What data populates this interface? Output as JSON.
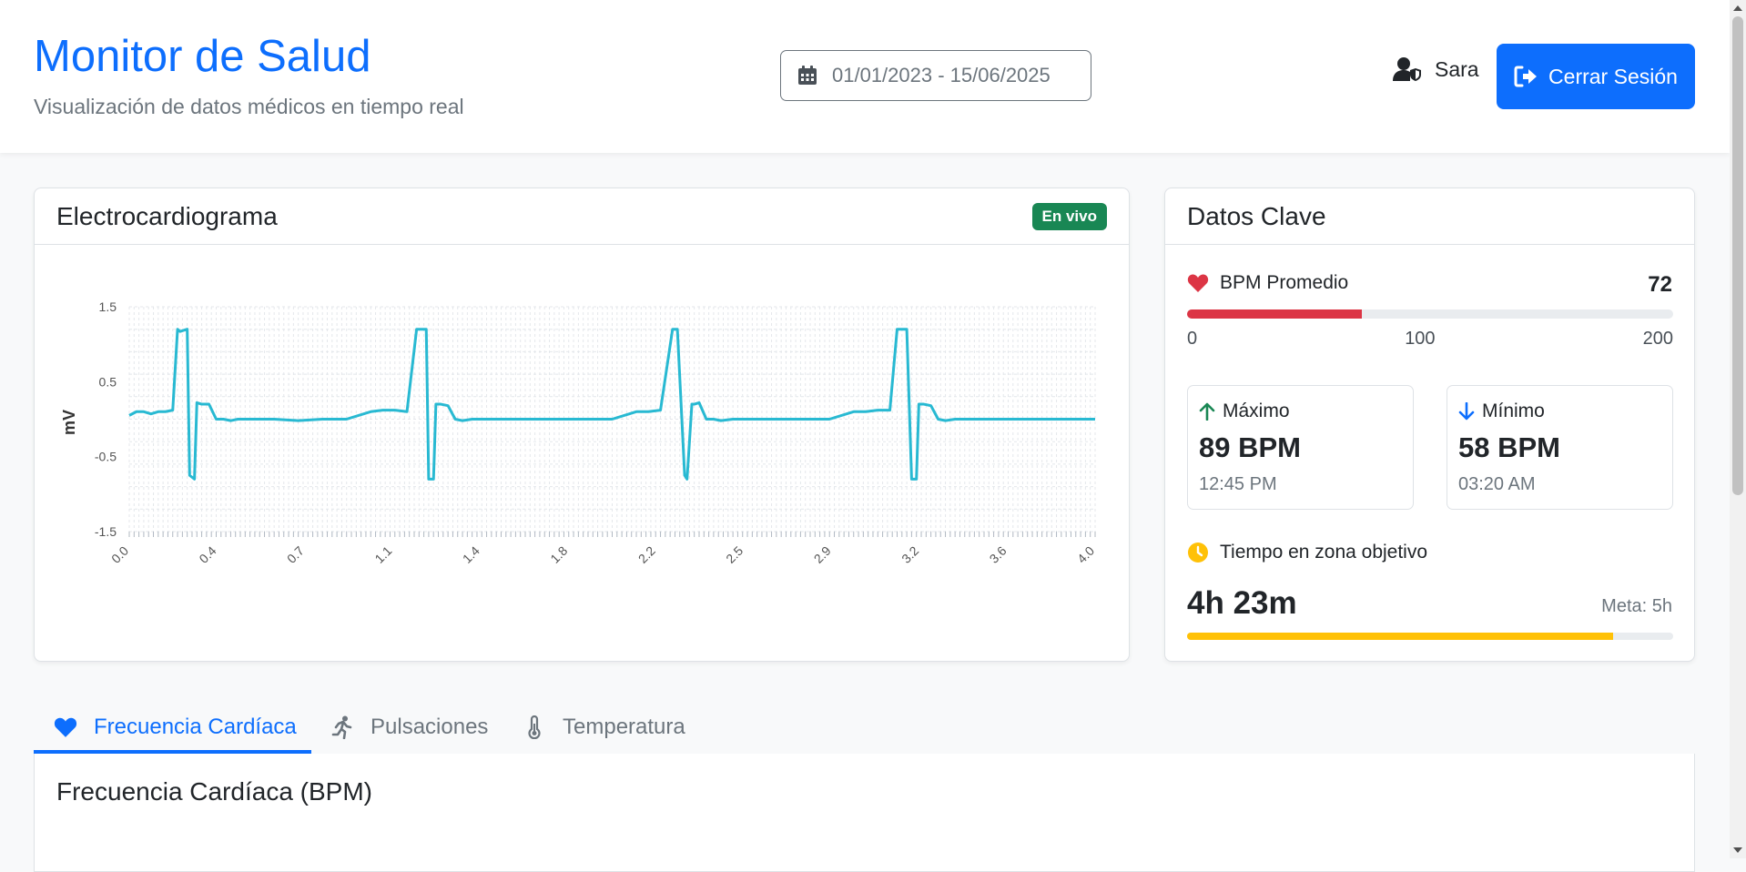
{
  "header": {
    "title": "Monitor de Salud",
    "subtitle": "Visualización de datos médicos en tiempo real",
    "date_range": "01/01/2023 - 15/06/2025",
    "user_name": "Sara",
    "logout_label": "Cerrar Sesión"
  },
  "ecg": {
    "title": "Electrocardiograma",
    "badge": "En vivo",
    "badge_color": "#198754",
    "line_color": "#28b9d2"
  },
  "chart_data": {
    "type": "line",
    "title": "",
    "xlabel": "",
    "ylabel": "mV",
    "x_ticks": [
      "0.0",
      "0.4",
      "0.7",
      "1.1",
      "1.4",
      "1.8",
      "2.2",
      "2.5",
      "2.9",
      "3.2",
      "3.6",
      "4.0"
    ],
    "y_ticks": [
      "1.5",
      "0.5",
      "-0.5",
      "-1.5"
    ],
    "xlim": [
      0,
      4.0
    ],
    "ylim": [
      -1.5,
      1.5
    ],
    "grid": true,
    "series": [
      {
        "x": [
          0.0,
          0.03,
          0.06,
          0.09,
          0.12,
          0.15,
          0.18,
          0.2,
          0.21,
          0.24,
          0.25,
          0.27,
          0.28,
          0.3,
          0.33,
          0.36,
          0.39,
          0.42,
          0.45,
          0.5,
          0.6,
          0.7,
          0.8,
          0.9,
          1.0,
          1.05,
          1.1,
          1.15,
          1.19,
          1.2,
          1.23,
          1.24,
          1.26,
          1.27,
          1.29,
          1.32,
          1.35,
          1.38,
          1.42,
          1.5,
          1.6,
          1.7,
          1.8,
          1.9,
          2.0,
          2.1,
          2.15,
          2.2,
          2.25,
          2.27,
          2.3,
          2.31,
          2.33,
          2.34,
          2.36,
          2.39,
          2.42,
          2.45,
          2.5,
          2.6,
          2.7,
          2.8,
          2.9,
          3.0,
          3.05,
          3.1,
          3.15,
          3.18,
          3.2,
          3.22,
          3.24,
          3.26,
          3.27,
          3.29,
          3.32,
          3.35,
          3.38,
          3.42,
          3.5,
          3.6,
          3.7,
          3.8,
          3.9,
          4.0
        ],
        "y": [
          0.05,
          0.1,
          0.1,
          0.07,
          0.1,
          0.1,
          0.12,
          1.2,
          1.17,
          1.2,
          -0.75,
          -0.8,
          0.22,
          0.2,
          0.2,
          0.0,
          0.0,
          -0.02,
          0.0,
          0.0,
          0.0,
          -0.02,
          0.0,
          0.0,
          0.1,
          0.12,
          0.12,
          0.1,
          1.2,
          1.2,
          1.2,
          -0.8,
          -0.8,
          0.2,
          0.2,
          0.18,
          0.0,
          -0.02,
          0.0,
          0.0,
          0.0,
          0.0,
          0.0,
          0.0,
          0.0,
          0.1,
          0.1,
          0.12,
          1.2,
          1.2,
          -0.75,
          -0.8,
          0.2,
          0.2,
          0.22,
          0.0,
          0.0,
          -0.02,
          0.0,
          0.0,
          0.0,
          0.0,
          0.0,
          0.1,
          0.1,
          0.12,
          0.12,
          1.2,
          1.2,
          1.2,
          -0.8,
          -0.8,
          0.2,
          0.2,
          0.18,
          0.0,
          -0.02,
          0.0,
          0.0,
          0.0,
          0.0,
          0.0,
          0.0,
          0.0
        ]
      }
    ]
  },
  "key_data": {
    "title": "Datos Clave",
    "bpm_label": "BPM Promedio",
    "bpm_value": "72",
    "bpm_fraction": 0.36,
    "bpm_color": "#dc3545",
    "scale": [
      "0",
      "100",
      "200"
    ],
    "max_label": "Máximo",
    "max_value": "89 BPM",
    "max_time": "12:45 PM",
    "min_label": "Mínimo",
    "min_value": "58 BPM",
    "min_time": "03:20 AM",
    "target_label": "Tiempo en zona objetivo",
    "target_value": "4h 23m",
    "target_goal": "Meta: 5h",
    "target_fraction": 0.877,
    "target_color": "#ffc107"
  },
  "tabs": {
    "items": [
      {
        "label": "Frecuencia Cardíaca",
        "icon": "heart-icon"
      },
      {
        "label": "Pulsaciones",
        "icon": "running-icon"
      },
      {
        "label": "Temperatura",
        "icon": "thermometer-icon"
      }
    ],
    "active_index": 0
  },
  "panel": {
    "title": "Frecuencia Cardíaca (BPM)"
  }
}
